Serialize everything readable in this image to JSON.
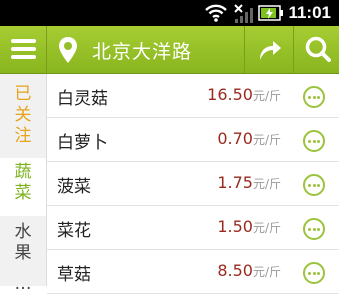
{
  "status_bar": {
    "time": "11:01"
  },
  "header": {
    "location": "北京大洋路"
  },
  "sidebar": {
    "categories": [
      {
        "lines": [
          "已",
          "关",
          "注"
        ]
      },
      {
        "lines": [
          "蔬",
          "菜"
        ]
      },
      {
        "lines": [
          "水",
          "果"
        ]
      },
      {
        "lines": [
          "…"
        ]
      }
    ]
  },
  "list": {
    "unit": "元/斤",
    "items": [
      {
        "name": "白灵菇",
        "price": "16.50"
      },
      {
        "name": "白萝卜",
        "price": "0.70"
      },
      {
        "name": "菠菜",
        "price": "1.75"
      },
      {
        "name": "菜花",
        "price": "1.50"
      },
      {
        "name": "草菇",
        "price": "8.50"
      }
    ]
  },
  "colors": {
    "accent": "#8cbc24",
    "price": "#9a2a1e",
    "followed": "#e8a21c"
  }
}
